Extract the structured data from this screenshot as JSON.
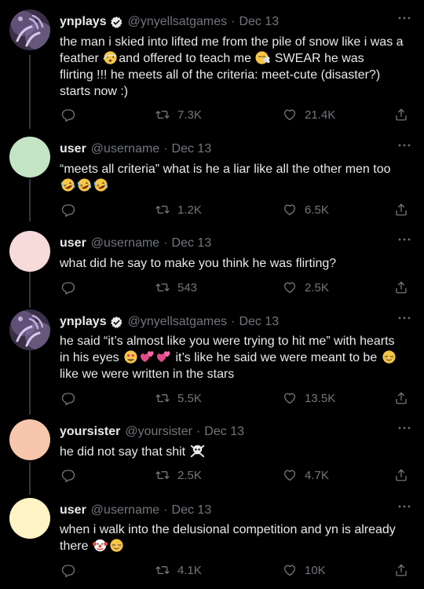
{
  "colors": {
    "background": "#000000",
    "text": "#e7e9ea",
    "muted": "#71767b",
    "thread_line": "#333639",
    "verified": "#e7e9ea"
  },
  "tweets": [
    {
      "name": "ynplays",
      "verified": true,
      "handle": "@ynyellsatgames",
      "date": "Dec 13",
      "avatar": "purple-hands-photo",
      "lines": [
        {
          "t1": "the man i skied into lifted me from the pile of snow like i was a"
        },
        {
          "t1": "feather ",
          "e1": "dizzy-face-emoji",
          "t2": "and offered to teach me ",
          "e2": "face-exhaling-emoji",
          "t3": " SWEAR he was"
        },
        {
          "t1": "flirting !!! he meets all of the criteria: meet-cute (disaster?)"
        },
        {
          "t1": "starts now :)"
        }
      ],
      "retweets": "7.3K",
      "likes": "21.4K"
    },
    {
      "name": "user",
      "handle": "@username",
      "date": "Dec 13",
      "avatar_color": "#c4e5c4",
      "lines": [
        {
          "t1": "“meets all criteria” what is he a liar like all the other men too"
        },
        {
          "e1": "rofl-emoji",
          "e2": "rofl-emoji",
          "e3": "rofl-emoji"
        }
      ],
      "retweets": "1.2K",
      "likes": "6.5K"
    },
    {
      "name": "user",
      "handle": "@username",
      "date": "Dec 13",
      "avatar_color": "#f7dada",
      "lines": [
        {
          "t1": "what did he say to make you think he was flirting?"
        }
      ],
      "retweets": "543",
      "likes": "2.5K"
    },
    {
      "name": "ynplays",
      "verified": true,
      "handle": "@ynyellsatgames",
      "date": "Dec 13",
      "avatar": "purple-hands-photo",
      "lines": [
        {
          "t1": "he said “it’s almost like you were trying to hit me” with hearts"
        },
        {
          "t1": "in his eyes ",
          "e1": "heart-eyes-emoji",
          "e2": "revolving-hearts-emoji",
          "e3": "revolving-hearts-emoji",
          "t2": " it’s like he said we were meant to be ",
          "e4": "relieved-face-emoji"
        },
        {
          "t1": "like we were written in the stars"
        }
      ],
      "retweets": "5.5K",
      "likes": "13.5K"
    },
    {
      "name": "yoursister",
      "handle": "@yoursister",
      "date": "Dec 13",
      "avatar_color": "#f7c6ad",
      "lines": [
        {
          "t1": "he did not say that shit ",
          "e1": "skull-crossbones-emoji"
        }
      ],
      "retweets": "2.5K",
      "likes": "4.7K"
    },
    {
      "name": "user",
      "handle": "@username",
      "date": "Dec 13",
      "avatar_color": "#fdf3c4",
      "lines": [
        {
          "t1": "when i walk into the delusional competition and yn is already"
        },
        {
          "t1": "there ",
          "e1": "clown-face-emoji",
          "e2": "relieved-face-emoji"
        }
      ],
      "retweets": "4.1K",
      "likes": "10K"
    }
  ]
}
